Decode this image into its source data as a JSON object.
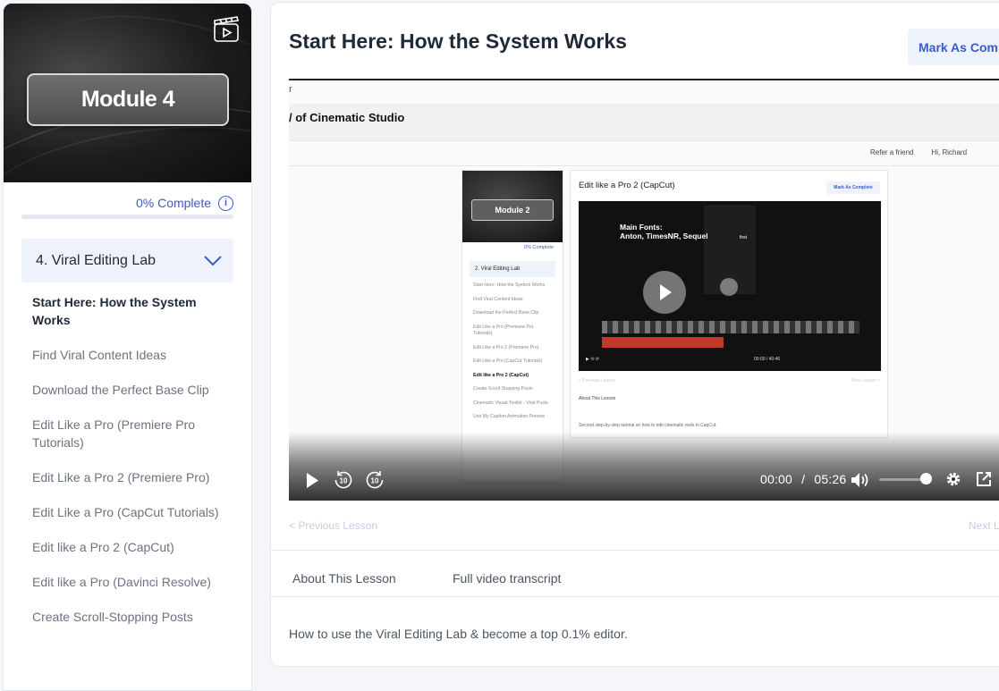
{
  "sidebar": {
    "module_title": "Module 4",
    "progress_text": "0% Complete",
    "progress_percent": 0,
    "section_title": "4. Viral Editing Lab",
    "lessons": [
      {
        "label": "Start Here: How the System Works",
        "active": true
      },
      {
        "label": "Find Viral Content Ideas",
        "active": false
      },
      {
        "label": "Download the Perfect Base Clip",
        "active": false
      },
      {
        "label": "Edit Like a Pro (Premiere Pro Tutorials)",
        "active": false
      },
      {
        "label": "Edit Like a Pro 2 (Premiere Pro)",
        "active": false
      },
      {
        "label": "Edit Like a Pro (CapCut Tutorials)",
        "active": false
      },
      {
        "label": "Edit like a Pro 2 (CapCut)",
        "active": false
      },
      {
        "label": "Edit like a Pro (Davinci Resolve)",
        "active": false
      },
      {
        "label": "Create Scroll-Stopping Posts",
        "active": false
      }
    ]
  },
  "main": {
    "title": "Start Here: How the System Works",
    "complete_button": "Mark As Comp",
    "video": {
      "crumb": "r",
      "site_title": "/ of Cinematic Studio",
      "refer_link": "Refer a friend",
      "greeting": "Hi, Richard",
      "current_time": "00:00",
      "duration": "05:26",
      "volume": 1,
      "nested": {
        "module_title": "Module 2",
        "progress_text": "0% Complete",
        "section_title": "2. Viral Editing Lab",
        "lessons": [
          "Start Here: How the System Works",
          "Find Viral Content Ideas",
          "Download the Perfect Base Clip",
          "Edit Like a Pro (Premiere Pro Tutorials)",
          "Edit Like a Pro 2 (Premiere Pro)",
          "Edit Like a Pro (CapCut Tutorials)",
          "Edit like a Pro 2 (CapCut)",
          "Create Scroll-Stopping Posts",
          "Cinematic Visual Toolkit - Viral Posts",
          "Use My Caption Animation Presets"
        ],
        "lesson_title": "Edit like a Pro 2 (CapCut)",
        "complete_button": "Mark As Complete",
        "fonts_caption": "Main Fonts:\nAnton, TimesNR, Sequel",
        "reel_caption": "first",
        "time_readout": "00:00 / 40:46",
        "prev": "< Previous Lesson",
        "next": "Next Lesson >",
        "about_tab": "About This Lesson",
        "description": "Second step-by-step tutorial on how to edit cinematic reels in CapCut."
      }
    },
    "prev_lesson": "< Previous Lesson",
    "next_lesson": "Next L",
    "tabs": [
      "About This Lesson",
      "Full video transcript"
    ],
    "description": "How to use the Viral Editing Lab & become a top 0.1% editor."
  },
  "colors": {
    "accent": "#3b5bcc",
    "muted": "#6b7280",
    "section_bg": "#eef3fb"
  },
  "icons": [
    "clapperboard-icon",
    "info-icon",
    "chevron-down-icon",
    "play-icon",
    "rewind-10-icon",
    "forward-10-icon",
    "volume-icon",
    "settings-gear-icon",
    "external-link-icon"
  ]
}
